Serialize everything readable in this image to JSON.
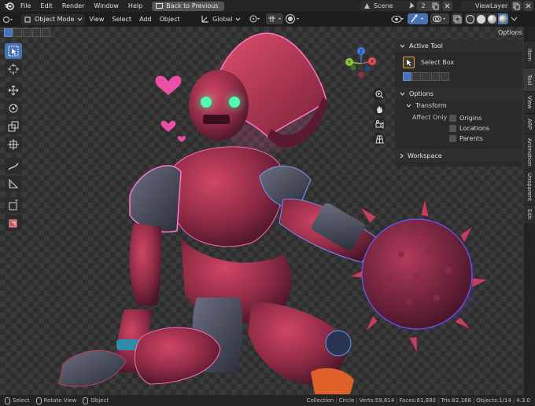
{
  "app": {
    "menu": [
      "File",
      "Edit",
      "Render",
      "Window",
      "Help"
    ],
    "back_label": "Back to Previous",
    "scene": "Scene",
    "scene_users": "2",
    "view_layer": "ViewLayer"
  },
  "viewport_header": {
    "mode": "Object Mode",
    "menus": [
      "View",
      "Select",
      "Add",
      "Object"
    ],
    "transform_orientation": "Global",
    "options_label": "Options"
  },
  "npanel": {
    "active_tool": {
      "title": "Active Tool",
      "tool_name": "Select Box"
    },
    "options": {
      "title": "Options",
      "transform_title": "Transform",
      "affect_only_label": "Affect Only",
      "checkboxes": [
        "Origins",
        "Locations",
        "Parents"
      ]
    },
    "workspace": {
      "title": "Workspace"
    }
  },
  "tabs": [
    "Item",
    "Tool",
    "View",
    "ARP",
    "Animation",
    "Unsparent",
    "Edit"
  ],
  "status_bar": {
    "select": "Select",
    "rotate": "Rotate View",
    "object": "Object",
    "stats": [
      "Collection",
      "Circle",
      "Verts:59,814",
      "Faces:81,880",
      "Tris:82,168",
      "Objects:1/14",
      "4.3.0"
    ]
  },
  "colors": {
    "accent": "#4772b3",
    "gizmo_x": "#e84d5e",
    "gizmo_y": "#8fc63d",
    "gizmo_z": "#3f7de0",
    "robot": "#a8304c",
    "heart": "#ec4fa6"
  }
}
